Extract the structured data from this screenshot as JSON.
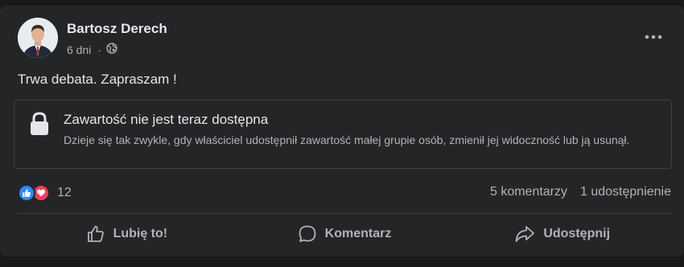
{
  "post": {
    "author": "Bartosz Derech",
    "time": "6 dni",
    "separator": "·",
    "privacy_icon": "globe-icon",
    "text": "Trwa debata. Zapraszam !",
    "unavailable": {
      "title": "Zawartość nie jest teraz dostępna",
      "description": "Dzieje się tak zwykle, gdy właściciel udostępnił zawartość małej grupie osób, zmienił jej widoczność lub ją usunął."
    },
    "reactions": {
      "icons": [
        "like-reaction-icon",
        "love-reaction-icon"
      ],
      "count": "12"
    },
    "comments": "5 komentarzy",
    "shares": "1 udostępnienie",
    "actions": {
      "like": "Lubię to!",
      "comment": "Komentarz",
      "share": "Udostępnij"
    }
  },
  "colors": {
    "background": "#18191a",
    "card": "#242526",
    "text_primary": "#e4e6eb",
    "text_secondary": "#b0b3b8",
    "like_blue": "#2d88ff",
    "love_red": "#f33e58"
  }
}
